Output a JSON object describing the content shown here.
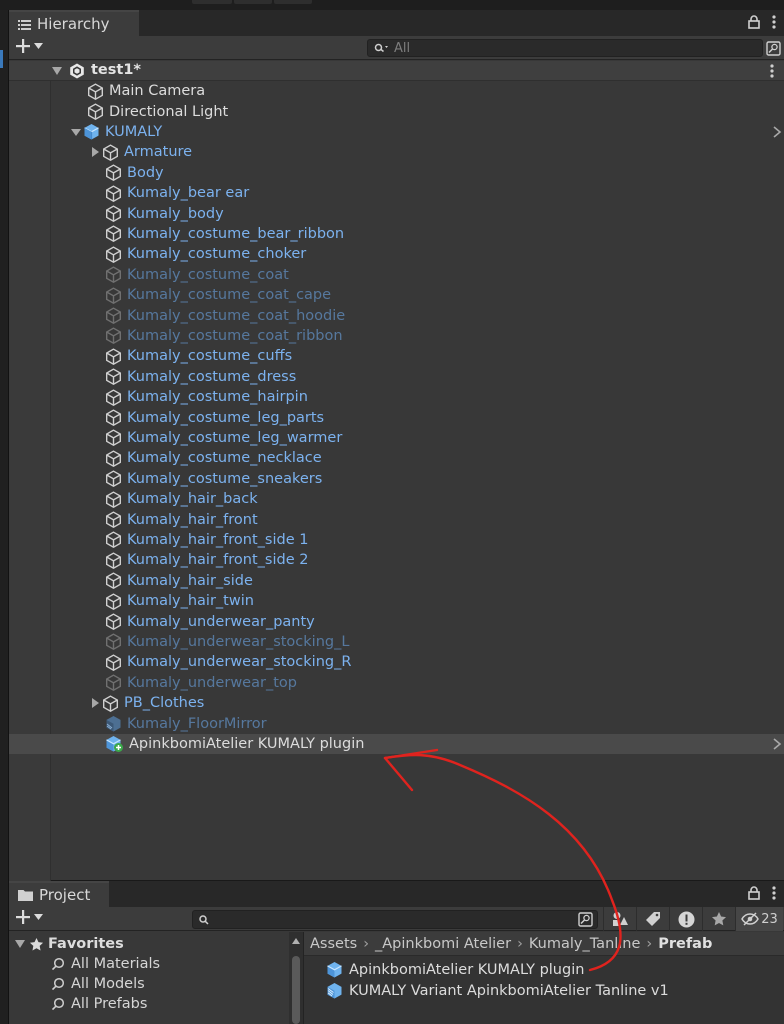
{
  "hierarchy": {
    "tab_title": "Hierarchy",
    "search_placeholder": "All",
    "scene_name": "test1*",
    "rows": [
      {
        "label": "Main Camera"
      },
      {
        "label": "Directional Light"
      },
      {
        "label": "KUMALY"
      },
      {
        "label": "Armature"
      },
      {
        "label": "Body"
      },
      {
        "label": "Kumaly_bear ear"
      },
      {
        "label": "Kumaly_body"
      },
      {
        "label": "Kumaly_costume_bear_ribbon"
      },
      {
        "label": "Kumaly_costume_choker"
      },
      {
        "label": "Kumaly_costume_coat"
      },
      {
        "label": "Kumaly_costume_coat_cape"
      },
      {
        "label": "Kumaly_costume_coat_hoodie"
      },
      {
        "label": "Kumaly_costume_coat_ribbon"
      },
      {
        "label": "Kumaly_costume_cuffs"
      },
      {
        "label": "Kumaly_costume_dress"
      },
      {
        "label": "Kumaly_costume_hairpin"
      },
      {
        "label": "Kumaly_costume_leg_parts"
      },
      {
        "label": "Kumaly_costume_leg_warmer"
      },
      {
        "label": "Kumaly_costume_necklace"
      },
      {
        "label": "Kumaly_costume_sneakers"
      },
      {
        "label": "Kumaly_hair_back"
      },
      {
        "label": "Kumaly_hair_front"
      },
      {
        "label": "Kumaly_hair_front_side 1"
      },
      {
        "label": "Kumaly_hair_front_side 2"
      },
      {
        "label": "Kumaly_hair_side"
      },
      {
        "label": "Kumaly_hair_twin"
      },
      {
        "label": "Kumaly_underwear_panty"
      },
      {
        "label": "Kumaly_underwear_stocking_L"
      },
      {
        "label": "Kumaly_underwear_stocking_R"
      },
      {
        "label": "Kumaly_underwear_top"
      },
      {
        "label": "PB_Clothes"
      },
      {
        "label": "Kumaly_FloorMirror"
      },
      {
        "label": "ApinkbomiAtelier KUMALY plugin"
      }
    ]
  },
  "project": {
    "tab_title": "Project",
    "hidden_count": "23",
    "favorites": {
      "title": "Favorites",
      "items": [
        {
          "label": "All Materials"
        },
        {
          "label": "All Models"
        },
        {
          "label": "All Prefabs"
        }
      ]
    },
    "breadcrumb": [
      "Assets",
      "_Apinkbomi Atelier",
      "Kumaly_Tanline",
      "Prefab"
    ],
    "assets": [
      {
        "label": "ApinkbomiAtelier KUMALY plugin"
      },
      {
        "label": "KUMALY Variant ApinkbomiAtelier Tanline v1"
      }
    ]
  },
  "colors": {
    "panel": "#383838",
    "prefab_text": "#7cb2ef",
    "inactive_text": "#56789e",
    "annotation": "#e0231e"
  }
}
